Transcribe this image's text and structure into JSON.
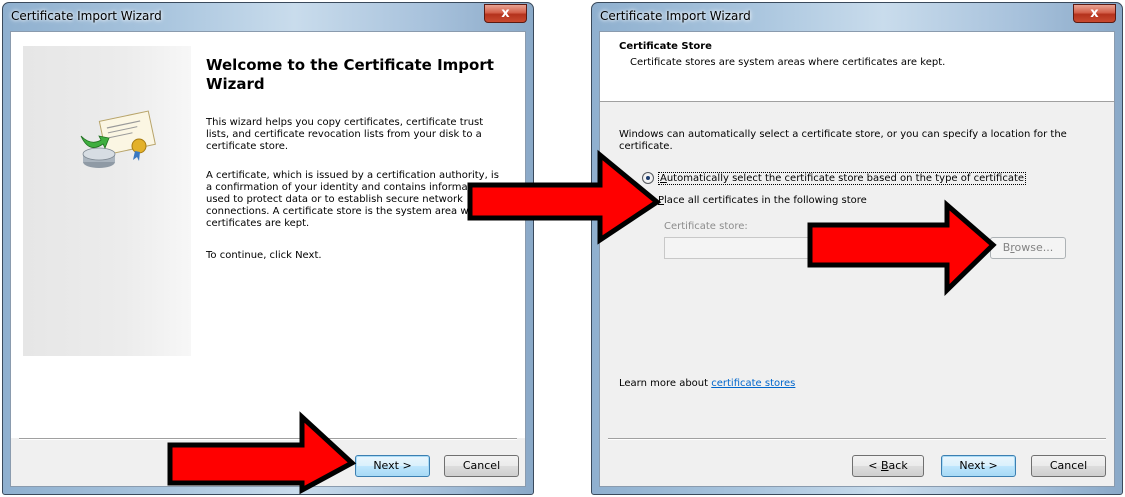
{
  "left_window": {
    "title": "Certificate Import Wizard",
    "close_symbol": "x",
    "welcome_title": "Welcome to the Certificate Import Wizard",
    "para1": "This wizard helps you copy certificates, certificate trust lists, and certificate revocation lists from your disk to a certificate store.",
    "para2": "A certificate, which is issued by a certification authority, is a confirmation of your identity and contains information used to protect data or to establish secure network connections. A certificate store is the system area where certificates are kept.",
    "para3": "To continue, click Next.",
    "next_label": "Next >",
    "cancel_label": "Cancel",
    "icon": "certificate-import-icon"
  },
  "right_window": {
    "title": "Certificate Import Wizard",
    "close_symbol": "x",
    "section_title": "Certificate Store",
    "section_sub": "Certificate stores are system areas where certificates are kept.",
    "description": "Windows can automatically select a certificate store, or you can specify a location for the certificate.",
    "radio_auto": {
      "accel": "A",
      "rest": "utomatically select the certificate store based on the type of certificate",
      "checked": true
    },
    "radio_place": {
      "accel": "P",
      "rest": "lace all certificates in the following store",
      "checked": false
    },
    "store_label": "Certificate store:",
    "store_value": "",
    "browse": {
      "pre": "B",
      "accel": "r",
      "post": "owse..."
    },
    "learn_text": "Learn more about ",
    "learn_link": "certificate stores",
    "back": {
      "pre": "< ",
      "accel": "B",
      "post": "ack"
    },
    "next_label": "Next >",
    "cancel_label": "Cancel"
  },
  "colors": {
    "arrow_fill": "#ff0000",
    "arrow_stroke": "#000000",
    "link": "#0066cc"
  }
}
